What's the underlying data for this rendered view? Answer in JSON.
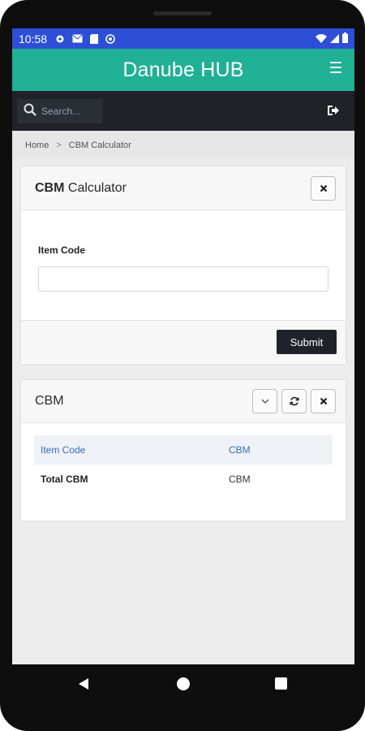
{
  "status_bar": {
    "time": "10:58",
    "icons": [
      "settings-icon",
      "mail-icon",
      "sim-icon",
      "sync-icon"
    ],
    "right_icons": [
      "wifi-icon",
      "signal-icon",
      "battery-icon"
    ]
  },
  "app": {
    "title": "Danube HUB",
    "menu_icon": "hamburger-menu-icon"
  },
  "search": {
    "placeholder": "Search..."
  },
  "breadcrumb": {
    "home": "Home",
    "separator": ">",
    "current": "CBM Calculator"
  },
  "calculator_card": {
    "title_bold": "CBM",
    "title_rest": " Calculator",
    "field_label": "Item Code",
    "field_value": "",
    "submit_label": "Submit"
  },
  "cbm_card": {
    "title": "CBM",
    "table": {
      "headers": [
        "Item Code",
        "CBM"
      ],
      "rows": [
        [
          "Total CBM",
          "CBM"
        ]
      ]
    }
  },
  "colors": {
    "status_bar": "#2d4fd6",
    "app_bar": "#20b095",
    "search_bar": "#1f2228",
    "table_header_text": "#3a6db5"
  }
}
